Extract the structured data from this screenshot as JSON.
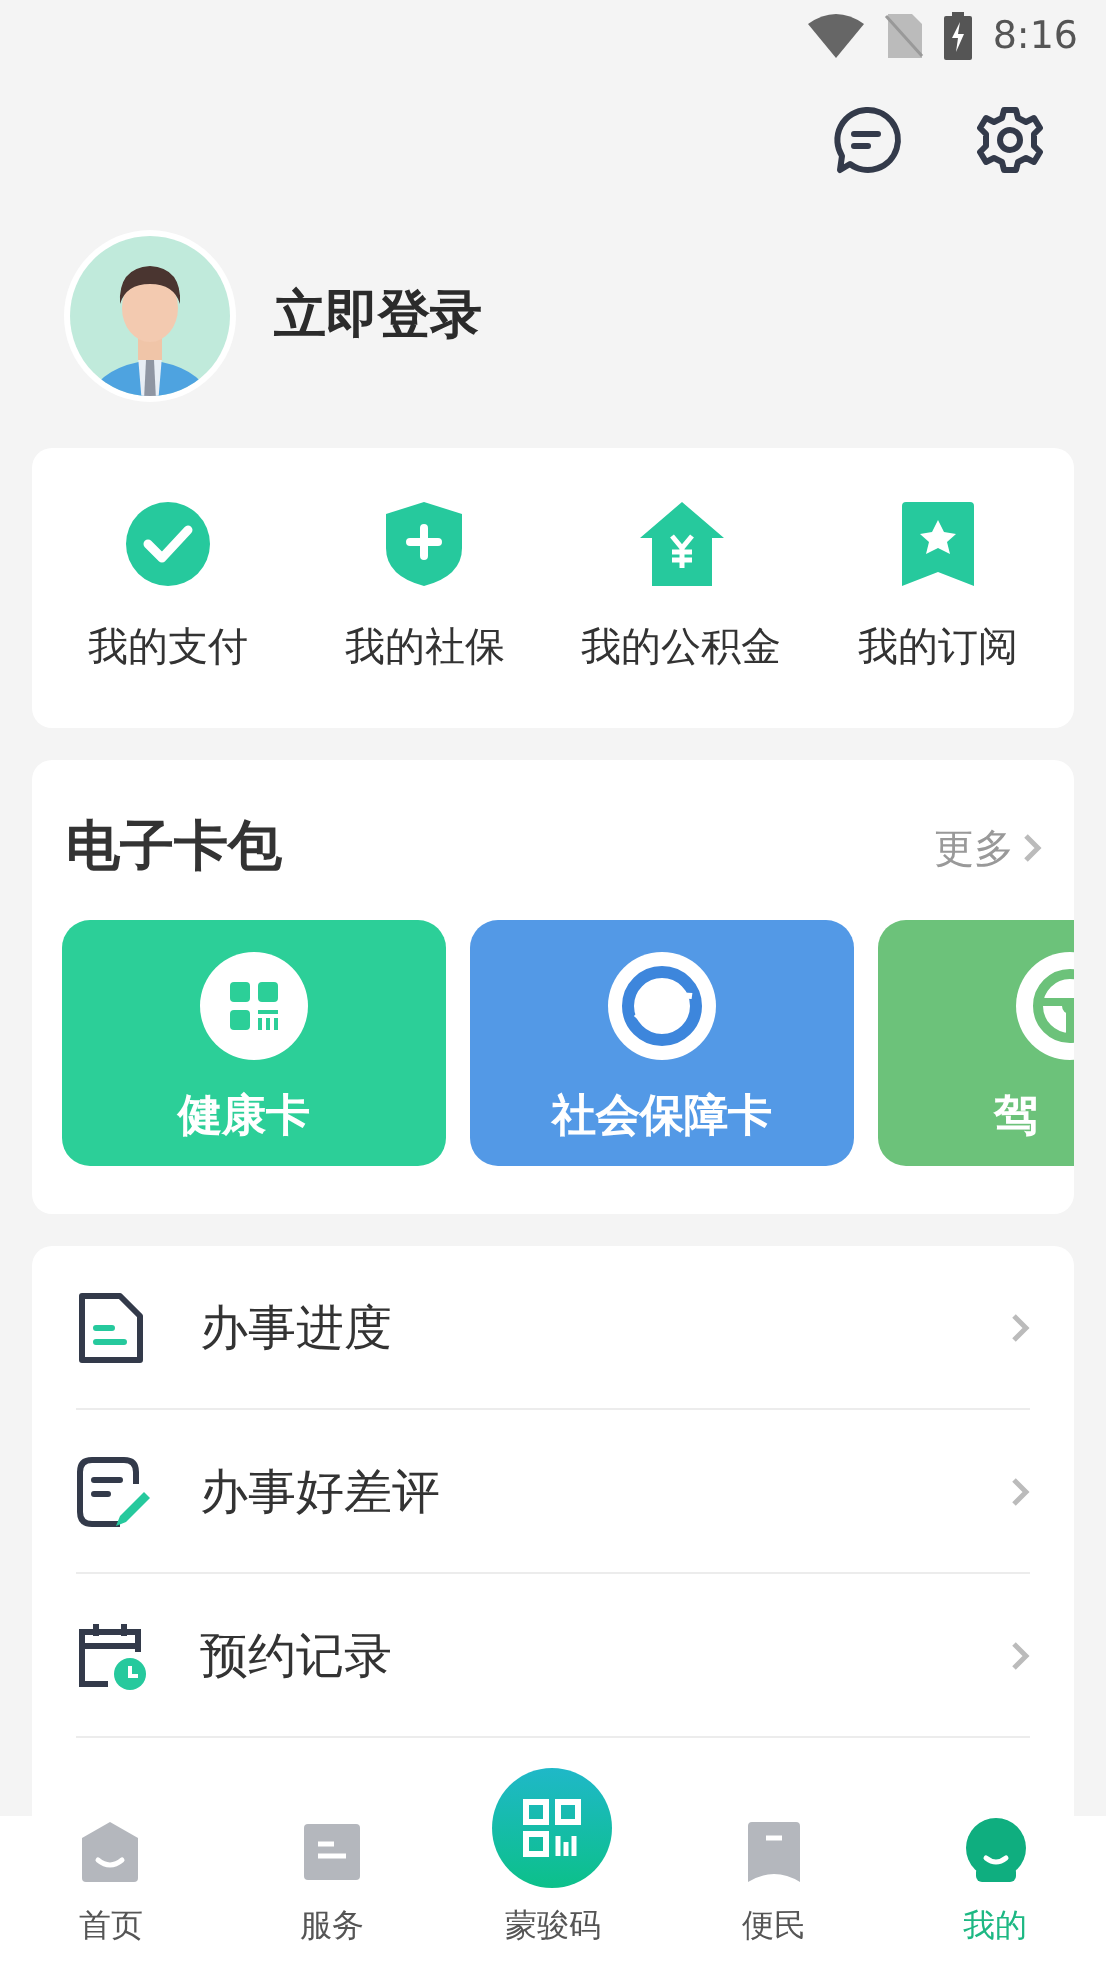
{
  "status_bar": {
    "time": "8:16"
  },
  "profile": {
    "login_text": "立即登录"
  },
  "quick_actions": [
    {
      "label": "我的支付"
    },
    {
      "label": "我的社保"
    },
    {
      "label": "我的公积金"
    },
    {
      "label": "我的订阅"
    }
  ],
  "wallet": {
    "title": "电子卡包",
    "more": "更多",
    "cards": [
      {
        "label": "健康卡",
        "color": "#2ccf98"
      },
      {
        "label": "社会保障卡",
        "color": "#5399e6"
      },
      {
        "label": "驾",
        "color": "#6cc27a"
      }
    ]
  },
  "menu": [
    {
      "label": "办事进度"
    },
    {
      "label": "办事好差评"
    },
    {
      "label": "预约记录"
    }
  ],
  "tab_bar": [
    {
      "label": "首页",
      "kind": "normal",
      "selected": false
    },
    {
      "label": "服务",
      "kind": "normal",
      "selected": false
    },
    {
      "label": "蒙骏码",
      "kind": "scan",
      "selected": false
    },
    {
      "label": "便民",
      "kind": "normal",
      "selected": false
    },
    {
      "label": "我的",
      "kind": "normal",
      "selected": true
    }
  ]
}
